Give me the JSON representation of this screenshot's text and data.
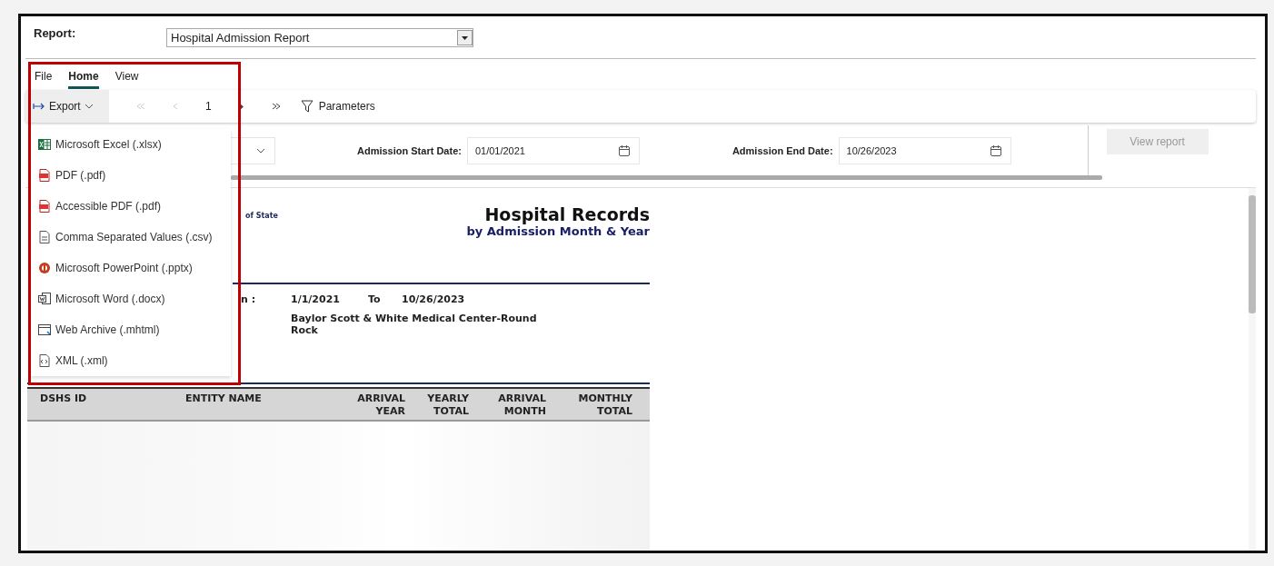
{
  "report_selector": {
    "label": "Report:",
    "value": "Hospital Admission Report"
  },
  "tabs": [
    {
      "label": "File",
      "selected": false
    },
    {
      "label": "Home",
      "selected": true
    },
    {
      "label": "View",
      "selected": false
    }
  ],
  "toolbar": {
    "export_label": "Export",
    "page_number": "1",
    "parameters_label": "Parameters"
  },
  "export_menu": [
    {
      "label": "Microsoft Excel (.xlsx)",
      "kind": "excel"
    },
    {
      "label": "PDF (.pdf)",
      "kind": "pdf"
    },
    {
      "label": "Accessible PDF (.pdf)",
      "kind": "pdf"
    },
    {
      "label": "Comma Separated Values (.csv)",
      "kind": "csv"
    },
    {
      "label": "Microsoft PowerPoint (.pptx)",
      "kind": "powerpoint"
    },
    {
      "label": "Microsoft Word (.docx)",
      "kind": "word"
    },
    {
      "label": "Web Archive (.mhtml)",
      "kind": "web"
    },
    {
      "label": "XML (.xml)",
      "kind": "xml"
    }
  ],
  "parameters": [
    {
      "label": "Admission Start Date:",
      "value": "01/01/2021"
    },
    {
      "label": "Admission End Date:",
      "value": "10/26/2023"
    }
  ],
  "view_report": {
    "label": "View report",
    "disabled": true
  },
  "report": {
    "logo_text": "of State",
    "title": "Hospital Records",
    "subtitle": "by Admission Month & Year",
    "date_label": "n :",
    "start_date": "1/1/2021",
    "to_label": "To",
    "end_date": "10/26/2023",
    "facility": "Baylor Scott & White Medical Center-Round Rock",
    "columns": [
      "DSHS ID",
      "ENTITY NAME",
      "ARRIVAL YEAR",
      "YEARLY TOTAL",
      "ARRIVAL MONTH",
      "MONTHLY TOTAL"
    ]
  }
}
